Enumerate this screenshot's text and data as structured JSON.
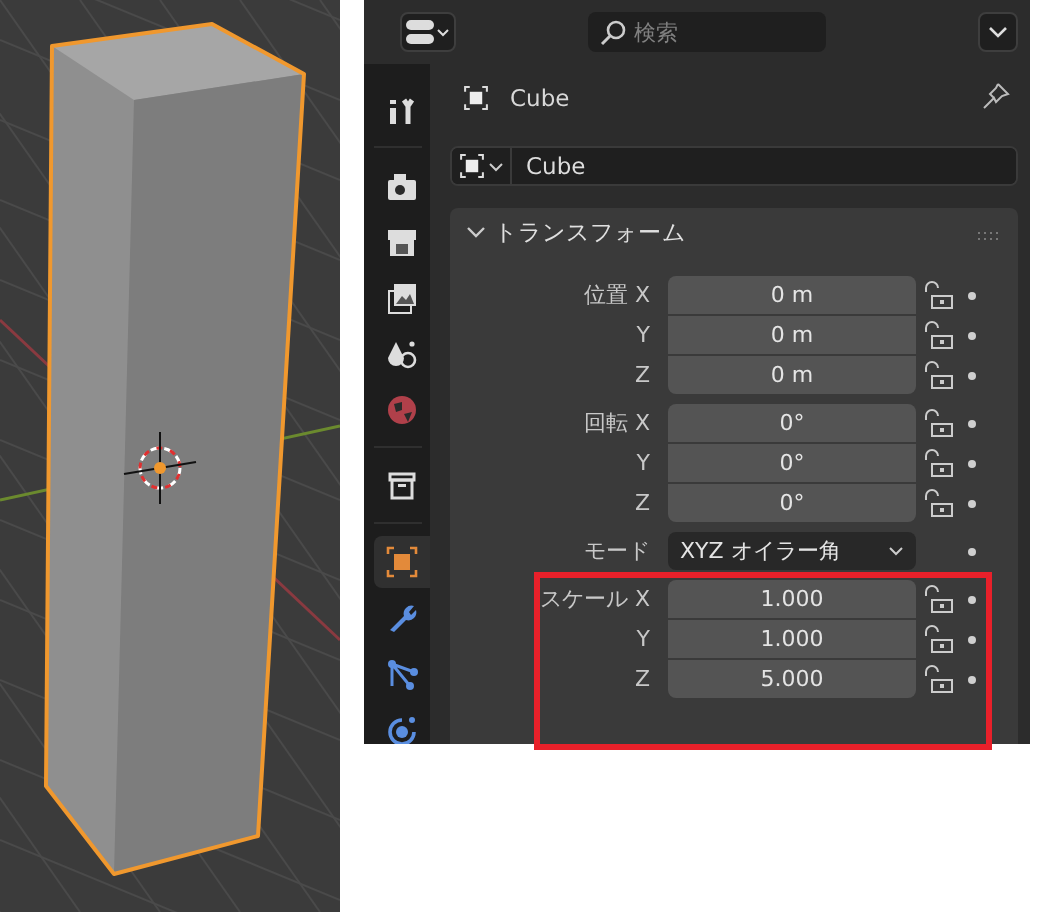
{
  "header": {
    "search": {
      "placeholder": "検索"
    }
  },
  "tabs": [
    {
      "kind": "tool",
      "selected": false
    },
    {
      "kind": "render",
      "selected": false
    },
    {
      "kind": "output",
      "selected": false
    },
    {
      "kind": "view_layer",
      "selected": false
    },
    {
      "kind": "scene",
      "selected": false
    },
    {
      "kind": "world",
      "selected": false
    },
    {
      "kind": "collection",
      "selected": false
    },
    {
      "kind": "object",
      "selected": true
    },
    {
      "kind": "modifiers",
      "selected": false
    },
    {
      "kind": "particles",
      "selected": false
    },
    {
      "kind": "physics",
      "selected": false
    }
  ],
  "object": {
    "name": "Cube"
  },
  "datablock": {
    "name": "Cube"
  },
  "panel": {
    "title": "トランスフォーム",
    "expanded": true,
    "groups": [
      {
        "kind": "vector",
        "rows": [
          {
            "label": "位置 X",
            "value": "0 m",
            "locked": false
          },
          {
            "label": "Y",
            "value": "0 m",
            "locked": false
          },
          {
            "label": "Z",
            "value": "0 m",
            "locked": false
          }
        ]
      },
      {
        "kind": "vector",
        "rows": [
          {
            "label": "回転 X",
            "value": "0°",
            "locked": false
          },
          {
            "label": "Y",
            "value": "0°",
            "locked": false
          },
          {
            "label": "Z",
            "value": "0°",
            "locked": false
          }
        ]
      },
      {
        "kind": "dropdown",
        "label": "モード",
        "value": "XYZ オイラー角"
      },
      {
        "kind": "vector",
        "highlighted": true,
        "rows": [
          {
            "label": "スケール X",
            "value": "1.000",
            "locked": false
          },
          {
            "label": "Y",
            "value": "1.000",
            "locked": false
          },
          {
            "label": "Z",
            "value": "5.000",
            "locked": false
          }
        ]
      }
    ]
  }
}
